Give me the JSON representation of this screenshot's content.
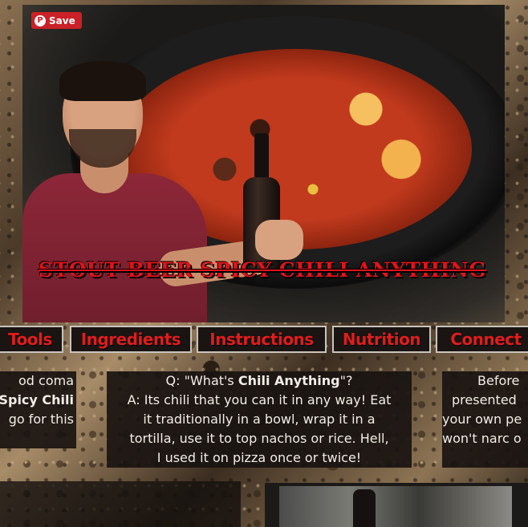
{
  "hero": {
    "save_label": "Save",
    "pin_icon": "pinterest-icon",
    "title": "STOUT BEER SPICY CHILI ANYTHING"
  },
  "nav": {
    "items": [
      {
        "label": "Tools"
      },
      {
        "label": "Ingredients"
      },
      {
        "label": "Instructions"
      },
      {
        "label": "Nutrition"
      },
      {
        "label": "Connect"
      }
    ]
  },
  "cards": {
    "left": {
      "lines": [
        "od coma",
        "Spicy Chili",
        "go for this"
      ]
    },
    "middle": {
      "question_prefix": "Q: \"What's ",
      "question_bold": "Chili Anything",
      "question_suffix": "\"?",
      "answer_lines": [
        "A: Its chili that you can it in any way! Eat",
        "it traditionally in a bowl, wrap it in a",
        "tortilla, use it to top nachos or rice. Hell,",
        "I used it on pizza once or twice!"
      ]
    },
    "right": {
      "lines": [
        "Before",
        "presented",
        "your own pe",
        "won't narc o"
      ]
    }
  },
  "colors": {
    "accent_red": "#e01d1d",
    "pinterest_red": "#cb2027",
    "card_bg": "#191411"
  }
}
